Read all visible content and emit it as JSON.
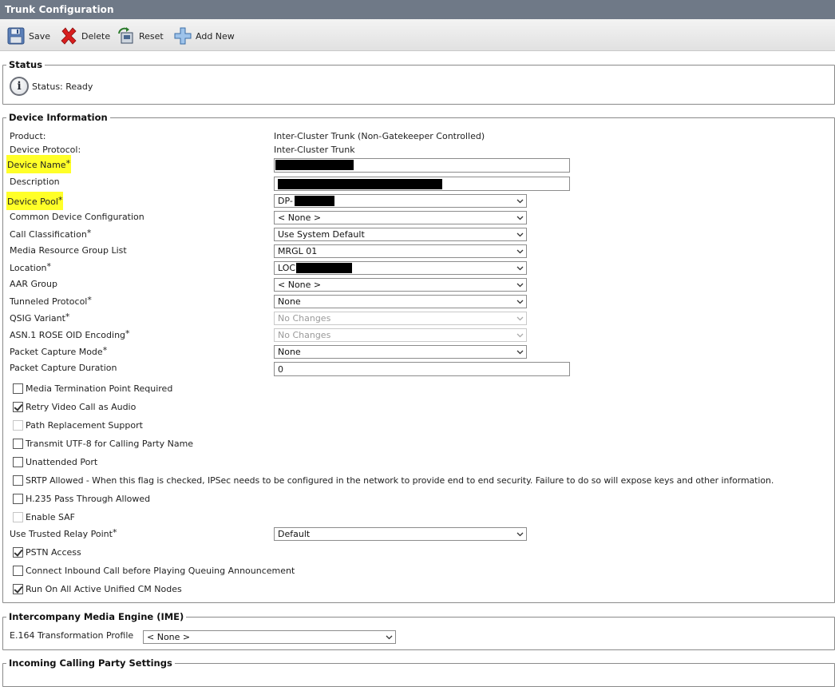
{
  "title": "Trunk Configuration",
  "toolbar": {
    "save": "Save",
    "delete": "Delete",
    "reset": "Reset",
    "add_new": "Add New"
  },
  "status": {
    "legend": "Status",
    "text": "Status: Ready"
  },
  "device": {
    "legend": "Device Information",
    "product_label": "Product:",
    "product_value": "Inter-Cluster Trunk (Non-Gatekeeper Controlled)",
    "protocol_label": "Device Protocol:",
    "protocol_value": "Inter-Cluster Trunk",
    "name_label": "Device Name",
    "description_label": "Description",
    "pool_label": "Device Pool",
    "pool_value": "DP-",
    "common_cfg_label": "Common Device Configuration",
    "common_cfg_value": "< None >",
    "call_class_label": "Call Classification",
    "call_class_value": "Use System Default",
    "mrgl_label": "Media Resource Group List",
    "mrgl_value": "MRGL 01",
    "location_label": "Location",
    "location_value": "LOC",
    "aar_label": "AAR Group",
    "aar_value": "< None >",
    "tunneled_label": "Tunneled Protocol",
    "tunneled_value": "None",
    "qsig_label": "QSIG Variant",
    "qsig_value": "No Changes",
    "asn_label": "ASN.1 ROSE OID Encoding",
    "asn_value": "No Changes",
    "pcap_mode_label": "Packet Capture Mode",
    "pcap_mode_value": "None",
    "pcap_dur_label": "Packet Capture Duration",
    "pcap_dur_value": "0",
    "checkboxes": [
      {
        "label": "Media Termination Point Required",
        "checked": false
      },
      {
        "label": "Retry Video Call as Audio",
        "checked": true
      },
      {
        "label": "Path Replacement Support",
        "checked": false,
        "disabled": true
      },
      {
        "label": "Transmit UTF-8 for Calling Party Name",
        "checked": false
      },
      {
        "label": "Unattended Port",
        "checked": false
      },
      {
        "label": "SRTP Allowed - When this flag is checked, IPSec needs to be configured in the network to provide end to end security. Failure to do so will expose keys and other information.",
        "checked": false
      },
      {
        "label": "H.235 Pass Through Allowed",
        "checked": false
      },
      {
        "label": "Enable SAF",
        "checked": false,
        "disabled": true
      }
    ],
    "trusted_relay_label": "Use Trusted Relay Point",
    "trusted_relay_value": "Default",
    "checkboxes2": [
      {
        "label": "PSTN Access",
        "checked": true
      },
      {
        "label": "Connect Inbound Call before Playing Queuing Announcement",
        "checked": false
      },
      {
        "label": "Run On All Active Unified CM Nodes",
        "checked": true
      }
    ]
  },
  "ime": {
    "legend": "Intercompany Media Engine (IME)",
    "e164_label": "E.164 Transformation Profile",
    "e164_value": "< None >"
  },
  "next_section": {
    "legend": "Incoming Calling Party Settings"
  },
  "required_mark": "*",
  "colors": {
    "titlebar": "#6f7987",
    "highlight": "#ffff28"
  }
}
